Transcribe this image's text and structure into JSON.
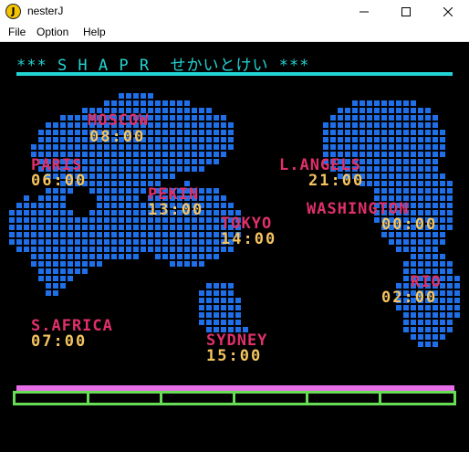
{
  "window": {
    "title": "nesterJ",
    "app_icon_letter": "J"
  },
  "menu": {
    "items": [
      "File",
      "Option",
      "Help"
    ]
  },
  "screen": {
    "banner": "*** S H A P R  せかいとけい ***",
    "cities": [
      {
        "name": "MOSCOW",
        "time": "08:00"
      },
      {
        "name": "PARIS",
        "time": "06:00"
      },
      {
        "name": "PEKIN",
        "time": "13:00"
      },
      {
        "name": "TOKYO",
        "time": "14:00"
      },
      {
        "name": "L.ANGELS",
        "time": "21:00"
      },
      {
        "name": "WASHINGTON",
        "time": "00:00"
      },
      {
        "name": "RIO",
        "time": "02:00"
      },
      {
        "name": "S.AFRICA",
        "time": "07:00"
      },
      {
        "name": "SYDNEY",
        "time": "15:00"
      }
    ]
  },
  "colors": {
    "map": "#1e6fe8",
    "city": "#e0306a",
    "time": "#f5c460",
    "banner": "#22d4d4",
    "pinkbar": "#e66ee6",
    "greenbar": "#66dd55"
  }
}
